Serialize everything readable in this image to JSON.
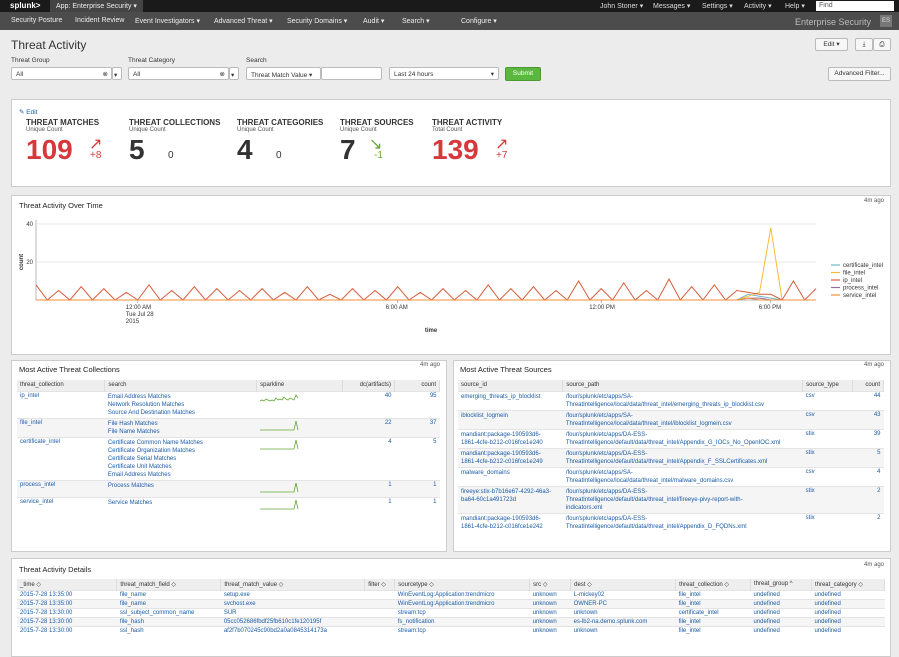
{
  "topbar": {
    "logo": "splunk>",
    "app": "App: Enterprise Security ▾",
    "user": "John Stoner ▾",
    "messages": "Messages ▾",
    "settings": "Settings ▾",
    "activity": "Activity ▾",
    "help": "Help ▾",
    "find_placeholder": "Find"
  },
  "nav": {
    "items": [
      "Security Posture",
      "Incident Review",
      "Event Investigators ▾",
      "Advanced Threat ▾",
      "Security Domains ▾",
      "Audit ▾",
      "Search ▾",
      "Configure ▾"
    ],
    "brand": "Enterprise Security",
    "brand_icon": "ES"
  },
  "page": {
    "title": "Threat Activity",
    "edit_label": "Edit ▾",
    "export_icon": "download-icon",
    "print_icon": "print-icon"
  },
  "filters": {
    "threat_group_label": "Threat Group",
    "threat_group_value": "All",
    "threat_category_label": "Threat Category",
    "threat_category_value": "All",
    "search_label": "Search",
    "search_field": "Threat Match Value ▾",
    "search_value": "",
    "time_range": "Last 24 hours",
    "submit": "Submit",
    "advanced": "Advanced Filter..."
  },
  "kpis": {
    "edit": "✎ Edit",
    "items": [
      {
        "title": "THREAT MATCHES",
        "sub": "Unique Count",
        "value": "109",
        "delta": "+8",
        "color": "#d6383c",
        "arrow": "↗"
      },
      {
        "title": "THREAT COLLECTIONS",
        "sub": "Unique Count",
        "value": "5",
        "delta": "0",
        "color": "#333333",
        "arrow": ""
      },
      {
        "title": "THREAT CATEGORIES",
        "sub": "Unique Count",
        "value": "4",
        "delta": "0",
        "color": "#333333",
        "arrow": ""
      },
      {
        "title": "THREAT SOURCES",
        "sub": "Unique Count",
        "value": "7",
        "delta": "-1",
        "color": "#333333",
        "arrow": "↘",
        "delta_color": "#65a637"
      },
      {
        "title": "THREAT ACTIVITY",
        "sub": "Total Count",
        "value": "139",
        "delta": "+7",
        "color": "#d6383c",
        "arrow": "↗"
      }
    ]
  },
  "overtime": {
    "title": "Threat Activity Over Time",
    "ago": "4m ago"
  },
  "chart_data": {
    "type": "line",
    "title": "Threat Activity Over Time",
    "xlabel": "time",
    "ylabel": "count",
    "ylim": [
      0,
      40
    ],
    "yticks": [
      "40",
      "20"
    ],
    "xticks": [
      "12:00 AM\nTue Jul 28\n2015",
      "6:00 AM",
      "12:00 PM",
      "6:00 PM"
    ],
    "legend_placement": "right",
    "series": [
      {
        "name": "certificate_intel",
        "color": "#6db7c6",
        "values": [
          0,
          0,
          0,
          0,
          0,
          0,
          0,
          0,
          0,
          0,
          0,
          0,
          0,
          0,
          0,
          0,
          0,
          0,
          0,
          0,
          0,
          0,
          0,
          0,
          0,
          0,
          0,
          0,
          0,
          0,
          0,
          0,
          0,
          0,
          0,
          0,
          0,
          0,
          0,
          0,
          0,
          0,
          0,
          0,
          0,
          0,
          0,
          0,
          0,
          0,
          0,
          0,
          0,
          0,
          0,
          0,
          0,
          0,
          0,
          0,
          0,
          0,
          0,
          3,
          2,
          1,
          0,
          0,
          0,
          0
        ]
      },
      {
        "name": "file_intel",
        "color": "#f7bc38",
        "values": [
          0,
          0,
          0,
          0,
          0,
          0,
          0,
          0,
          0,
          0,
          0,
          0,
          0,
          0,
          0,
          0,
          0,
          0,
          0,
          0,
          0,
          0,
          0,
          0,
          0,
          0,
          0,
          0,
          0,
          0,
          0,
          0,
          0,
          0,
          0,
          0,
          0,
          0,
          0,
          0,
          0,
          0,
          0,
          0,
          0,
          0,
          0,
          0,
          0,
          0,
          0,
          0,
          0,
          0,
          0,
          0,
          0,
          0,
          0,
          0,
          0,
          0,
          0,
          2,
          4,
          38,
          0,
          0,
          0,
          0
        ]
      },
      {
        "name": "ip_intel",
        "color": "#d85d3c",
        "values": [
          8,
          0,
          5,
          0,
          7,
          0,
          6,
          0,
          4,
          0,
          8,
          0,
          5,
          0,
          7,
          0,
          6,
          0,
          5,
          0,
          6,
          0,
          4,
          0,
          7,
          0,
          3,
          0,
          6,
          0,
          5,
          0,
          7,
          0,
          4,
          0,
          6,
          0,
          5,
          0,
          8,
          0,
          6,
          0,
          7,
          0,
          5,
          0,
          10,
          0,
          6,
          0,
          9,
          0,
          5,
          0,
          11,
          0,
          7,
          0,
          8,
          0,
          5,
          4,
          3,
          3,
          0,
          10,
          0,
          6
        ]
      },
      {
        "name": "process_intel",
        "color": "#956d95",
        "values": [
          0,
          0,
          0,
          0,
          0,
          0,
          0,
          0,
          0,
          0,
          0,
          0,
          0,
          0,
          0,
          0,
          0,
          0,
          0,
          0,
          0,
          0,
          0,
          0,
          0,
          0,
          0,
          0,
          0,
          0,
          0,
          0,
          0,
          0,
          0,
          0,
          0,
          0,
          0,
          0,
          0,
          0,
          0,
          0,
          0,
          0,
          0,
          0,
          0,
          0,
          0,
          0,
          0,
          0,
          0,
          0,
          0,
          0,
          0,
          0,
          0,
          0,
          0,
          1,
          1,
          0,
          0,
          0,
          0,
          0
        ]
      },
      {
        "name": "service_intel",
        "color": "#f58f39",
        "values": [
          0,
          0,
          0,
          0,
          0,
          0,
          0,
          0,
          0,
          0,
          0,
          0,
          0,
          0,
          0,
          0,
          0,
          0,
          0,
          0,
          0,
          0,
          0,
          0,
          0,
          0,
          0,
          0,
          0,
          0,
          0,
          0,
          0,
          0,
          0,
          0,
          0,
          0,
          0,
          0,
          0,
          0,
          0,
          0,
          0,
          0,
          0,
          0,
          0,
          0,
          0,
          0,
          0,
          0,
          0,
          0,
          0,
          0,
          0,
          0,
          0,
          0,
          0,
          1,
          0,
          0,
          0,
          0,
          0,
          0
        ]
      }
    ]
  },
  "collections": {
    "title": "Most Active Threat Collections",
    "ago": "4m ago",
    "columns": [
      "threat_collection",
      "search",
      "sparkline",
      "dc(artifacts)",
      "count"
    ],
    "rows": [
      {
        "collection": "ip_intel",
        "searches": [
          "Email Address Matches",
          "Network Resolution Matches",
          "Source And Destination Matches"
        ],
        "dc": "40",
        "count": "95"
      },
      {
        "collection": "file_intel",
        "searches": [
          "File Hash Matches",
          "File Name Matches"
        ],
        "dc": "22",
        "count": "37"
      },
      {
        "collection": "certificate_intel",
        "searches": [
          "Certificate Common Name Matches",
          "Certificate Organization Matches",
          "Certificate Serial Matches",
          "Certificate Unit Matches",
          "Email Address Matches"
        ],
        "dc": "4",
        "count": "5"
      },
      {
        "collection": "process_intel",
        "searches": [
          "Process Matches"
        ],
        "dc": "1",
        "count": "1"
      },
      {
        "collection": "service_intel",
        "searches": [
          "Service Matches"
        ],
        "dc": "1",
        "count": "1"
      }
    ]
  },
  "sources": {
    "title": "Most Active Threat Sources",
    "ago": "4m ago",
    "columns": [
      "source_id",
      "source_path",
      "source_type",
      "count"
    ],
    "rows": [
      {
        "id": [
          "emerging_threats_ip_blocklist"
        ],
        "path": [
          "/four/splunk/etc/apps/SA-",
          "ThreatIntelligence/local/data/threat_intel/emerging_threats_ip_blocklist.csv"
        ],
        "type": "csv",
        "count": "44"
      },
      {
        "id": [
          "iblocklist_logmein"
        ],
        "path": [
          "/four/splunk/etc/apps/SA-",
          "ThreatIntelligence/local/data/threat_intel/iblocklist_logmein.csv"
        ],
        "type": "csv",
        "count": "43"
      },
      {
        "id": [
          "mandiant:package-190593d6-",
          "1861-4cfe-b212-c016fce1e240"
        ],
        "path": [
          "/four/splunk/etc/apps/DA-ESS-",
          "ThreatIntelligence/default/data/threat_intel/Appendix_G_IOCs_No_OpenIOC.xml"
        ],
        "type": "stix",
        "count": "39"
      },
      {
        "id": [
          "mandiant:package-190593d6-",
          "1861-4cfe-b212-c016fce1e249"
        ],
        "path": [
          "/four/splunk/etc/apps/DA-ESS-",
          "ThreatIntelligence/default/data/threat_intel/Appendix_F_SSLCertificates.xml"
        ],
        "type": "stix",
        "count": "5"
      },
      {
        "id": [
          "malware_domains"
        ],
        "path": [
          "/four/splunk/etc/apps/SA-",
          "ThreatIntelligence/local/data/threat_intel/malware_domains.csv"
        ],
        "type": "csv",
        "count": "4"
      },
      {
        "id": [
          "fireeye:stix-b7b16e67-4292-46a3-",
          "ba64-60c1a491723d"
        ],
        "path": [
          "/four/splunk/etc/apps/DA-ESS-",
          "ThreatIntelligence/default/data/threat_intel/fireeye-pivy-report-with-",
          "indicators.xml"
        ],
        "type": "stix",
        "count": "2"
      },
      {
        "id": [
          "mandiant:package-190593d6-",
          "1861-4cfe-b212-c016fce1e242"
        ],
        "path": [
          "/four/splunk/etc/apps/DA-ESS-",
          "ThreatIntelligence/default/data/threat_intel/Appendix_D_FQDNs.xml"
        ],
        "type": "stix",
        "count": "2"
      }
    ]
  },
  "details": {
    "title": "Threat Activity Details",
    "ago": "4m ago",
    "columns": [
      "_time ◇",
      "threat_match_field ◇",
      "threat_match_value ◇",
      "filter ◇",
      "sourcetype ◇",
      "src ◇",
      "dest ◇",
      "threat_collection ◇",
      "threat_group ^",
      "threat_category ◇"
    ],
    "rows": [
      [
        "2015-7-28 13:35:00",
        "file_name",
        "setup.exe",
        "",
        "WinEventLog:Application:trendmicro",
        "unknown",
        "L-mickey02",
        "file_intel",
        "undefined",
        "undefined"
      ],
      [
        "2015-7-28 13:35:00",
        "file_name",
        "svchost.exe",
        "",
        "WinEventLog:Application:trendmicro",
        "unknown",
        "OWNER-PC",
        "file_intel",
        "undefined",
        "undefined"
      ],
      [
        "2015-7-28 13:30:00",
        "ssl_subject_common_name",
        "SUR",
        "",
        "stream:tcp",
        "unknown",
        "unknown",
        "certificate_intel",
        "undefined",
        "undefined"
      ],
      [
        "2015-7-28 13:30:00",
        "file_hash",
        "05cc052686fbdf25fb610c1fe120195f",
        "",
        "fs_notification",
        "unknown",
        "es-lb2-na.demo.splunk.com",
        "file_intel",
        "undefined",
        "undefined"
      ],
      [
        "2015-7-28 13:30:00",
        "ssl_hash",
        "af2f7b070245c90bd2a0a0845314173a",
        "",
        "stream:tcp",
        "unknown",
        "unknown",
        "file_intel",
        "undefined",
        "undefined"
      ]
    ]
  }
}
